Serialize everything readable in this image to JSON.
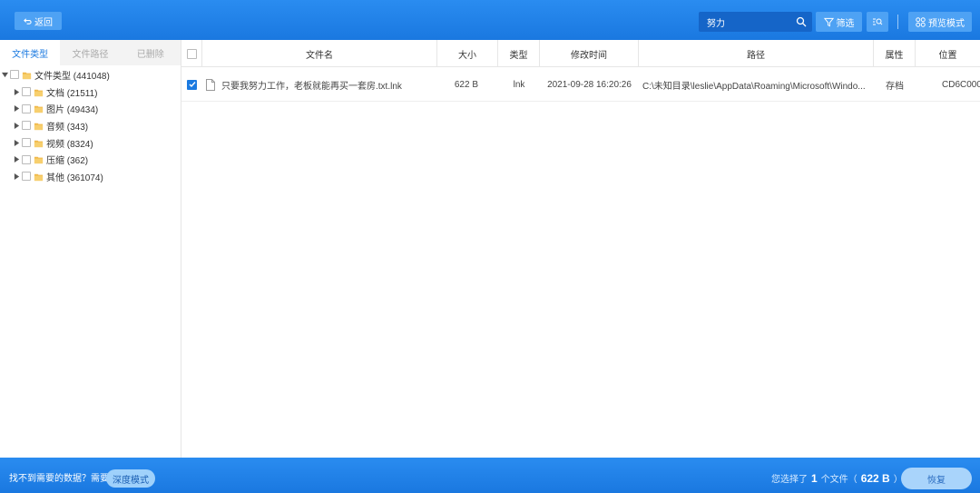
{
  "toolbar": {
    "back_label": "返回",
    "search_value": "努力",
    "filter_label": "筛选",
    "preview_label": "预览模式"
  },
  "sidebar": {
    "tabs": [
      {
        "label": "文件类型",
        "active": true
      },
      {
        "label": "文件路径",
        "active": false
      },
      {
        "label": "已删除",
        "active": false
      }
    ],
    "root": {
      "label": "文件类型 (441048)",
      "expanded": true
    },
    "items": [
      {
        "label": "文档 (21511)"
      },
      {
        "label": "图片 (49434)"
      },
      {
        "label": "音频 (343)"
      },
      {
        "label": "视频 (8324)"
      },
      {
        "label": "压缩 (362)"
      },
      {
        "label": "其他 (361074)"
      }
    ]
  },
  "table": {
    "headers": [
      "文件名",
      "大小",
      "类型",
      "修改时间",
      "路径",
      "属性",
      "位置"
    ],
    "rows": [
      {
        "checked": true,
        "name": "只要我努力工作，老板就能再买一套房.txt.lnk",
        "size": "622 B",
        "type": "lnk",
        "modified": "2021-09-28 16:20:26",
        "path": "C:\\未知目录\\leslie\\AppData\\Roaming\\Microsoft\\Windo...",
        "attribute": "存档",
        "location": "CD6C000"
      }
    ]
  },
  "footer": {
    "help_text": "找不到需要的数据？需要",
    "deep_mode_label": "深度模式",
    "status_prefix": "您选择了",
    "selected_count": "1",
    "status_mid": "个文件（",
    "selected_size": "622 B",
    "status_suffix": "）",
    "recover_label": "恢复"
  },
  "colors": {
    "accent": "#1b7ae0",
    "bar": "#2a8cf0",
    "folder": "#f0b84a"
  }
}
